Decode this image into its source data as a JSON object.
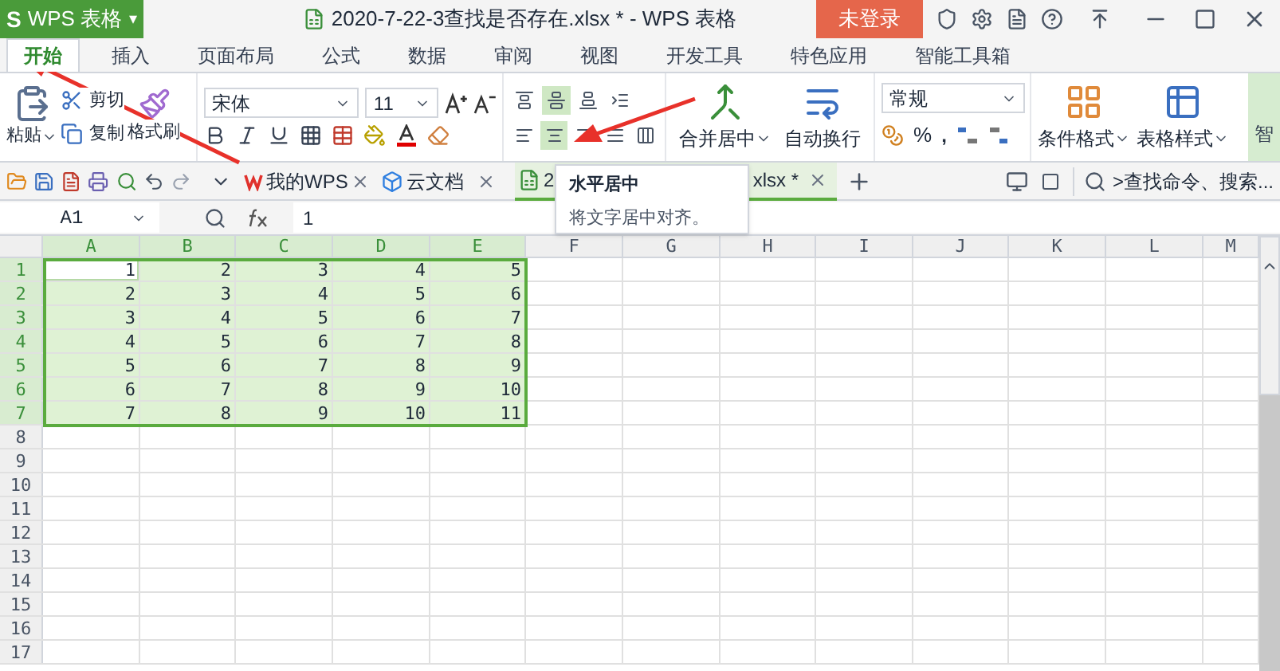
{
  "app_menu": {
    "label": "WPS 表格",
    "logo": "S",
    "caret": "▾"
  },
  "window": {
    "title": "2020-7-22-3查找是否存在.xlsx * - WPS 表格",
    "login": "未登录"
  },
  "ribbon_tabs": [
    {
      "label": "开始",
      "selected": true
    },
    {
      "label": "插入",
      "selected": false
    },
    {
      "label": "页面布局",
      "selected": false
    },
    {
      "label": "公式",
      "selected": false
    },
    {
      "label": "数据",
      "selected": false
    },
    {
      "label": "审阅",
      "selected": false
    },
    {
      "label": "视图",
      "selected": false
    },
    {
      "label": "开发工具",
      "selected": false
    },
    {
      "label": "特色应用",
      "selected": false
    },
    {
      "label": "智能工具箱",
      "selected": false
    }
  ],
  "clipboard": {
    "paste": "粘贴",
    "cut": "剪切",
    "copy": "复制",
    "format_painter": "格式刷"
  },
  "font": {
    "name": "宋体",
    "size": "11"
  },
  "align_top_row": [
    {
      "kind": "top",
      "selected": false
    },
    {
      "kind": "middle",
      "selected": true
    },
    {
      "kind": "bottom",
      "selected": false
    },
    {
      "kind": "indent",
      "selected": false
    }
  ],
  "align_bottom_row": [
    {
      "kind": "left",
      "selected": false
    },
    {
      "kind": "center",
      "selected": true
    },
    {
      "kind": "right",
      "selected": false
    },
    {
      "kind": "justify",
      "selected": false
    },
    {
      "kind": "distributed",
      "selected": false
    }
  ],
  "merge": {
    "label": "合并居中"
  },
  "wrap": {
    "label": "自动换行"
  },
  "number": {
    "format": "常规",
    "percent": "%",
    "comma": ","
  },
  "styles": {
    "conditional": "条件格式",
    "table_style": "表格样式",
    "smart": "智"
  },
  "doc_tabs": [
    {
      "label": "我的WPS",
      "kind": "wps",
      "selected": false
    },
    {
      "label": "云文档",
      "kind": "cloud",
      "selected": false
    },
    {
      "label": "2",
      "label_end": "xlsx *",
      "kind": "sheet",
      "selected": true
    }
  ],
  "search": {
    "placeholder": ">查找命令、搜索..."
  },
  "formula_bar": {
    "cell": "A1",
    "value": "1"
  },
  "tooltip": {
    "title": "水平居中",
    "text": "将文字居中对齐。"
  },
  "grid": {
    "columns": [
      {
        "label": "A",
        "selected": true
      },
      {
        "label": "B",
        "selected": true
      },
      {
        "label": "C",
        "selected": true
      },
      {
        "label": "D",
        "selected": true
      },
      {
        "label": "E",
        "selected": true
      },
      {
        "label": "F",
        "selected": false
      },
      {
        "label": "G",
        "selected": false
      },
      {
        "label": "H",
        "selected": false
      },
      {
        "label": "I",
        "selected": false
      },
      {
        "label": "J",
        "selected": false
      },
      {
        "label": "K",
        "selected": false
      },
      {
        "label": "L",
        "selected": false
      },
      {
        "label": "M",
        "selected": false
      }
    ],
    "rows": [
      {
        "label": "1",
        "selected": true,
        "cells": [
          {
            "value": "1",
            "active": true
          },
          {
            "value": "2",
            "active": false
          },
          {
            "value": "3",
            "active": false
          },
          {
            "value": "4",
            "active": false
          },
          {
            "value": "5",
            "active": false
          }
        ]
      },
      {
        "label": "2",
        "selected": true,
        "cells": [
          {
            "value": "2",
            "active": false
          },
          {
            "value": "3",
            "active": false
          },
          {
            "value": "4",
            "active": false
          },
          {
            "value": "5",
            "active": false
          },
          {
            "value": "6",
            "active": false
          }
        ]
      },
      {
        "label": "3",
        "selected": true,
        "cells": [
          {
            "value": "3",
            "active": false
          },
          {
            "value": "4",
            "active": false
          },
          {
            "value": "5",
            "active": false
          },
          {
            "value": "6",
            "active": false
          },
          {
            "value": "7",
            "active": false
          }
        ]
      },
      {
        "label": "4",
        "selected": true,
        "cells": [
          {
            "value": "4",
            "active": false
          },
          {
            "value": "5",
            "active": false
          },
          {
            "value": "6",
            "active": false
          },
          {
            "value": "7",
            "active": false
          },
          {
            "value": "8",
            "active": false
          }
        ]
      },
      {
        "label": "5",
        "selected": true,
        "cells": [
          {
            "value": "5",
            "active": false
          },
          {
            "value": "6",
            "active": false
          },
          {
            "value": "7",
            "active": false
          },
          {
            "value": "8",
            "active": false
          },
          {
            "value": "9",
            "active": false
          }
        ]
      },
      {
        "label": "6",
        "selected": true,
        "cells": [
          {
            "value": "6",
            "active": false
          },
          {
            "value": "7",
            "active": false
          },
          {
            "value": "8",
            "active": false
          },
          {
            "value": "9",
            "active": false
          },
          {
            "value": "10",
            "active": false
          }
        ]
      },
      {
        "label": "7",
        "selected": true,
        "cells": [
          {
            "value": "7",
            "active": false
          },
          {
            "value": "8",
            "active": false
          },
          {
            "value": "9",
            "active": false
          },
          {
            "value": "10",
            "active": false
          },
          {
            "value": "11",
            "active": false
          }
        ]
      },
      {
        "label": "8",
        "selected": false,
        "cells": []
      },
      {
        "label": "9",
        "selected": false,
        "cells": []
      },
      {
        "label": "10",
        "selected": false,
        "cells": []
      },
      {
        "label": "11",
        "selected": false,
        "cells": []
      },
      {
        "label": "12",
        "selected": false,
        "cells": []
      },
      {
        "label": "13",
        "selected": false,
        "cells": []
      },
      {
        "label": "14",
        "selected": false,
        "cells": []
      },
      {
        "label": "15",
        "selected": false,
        "cells": []
      },
      {
        "label": "16",
        "selected": false,
        "cells": []
      },
      {
        "label": "17",
        "selected": false,
        "cells": []
      }
    ]
  }
}
